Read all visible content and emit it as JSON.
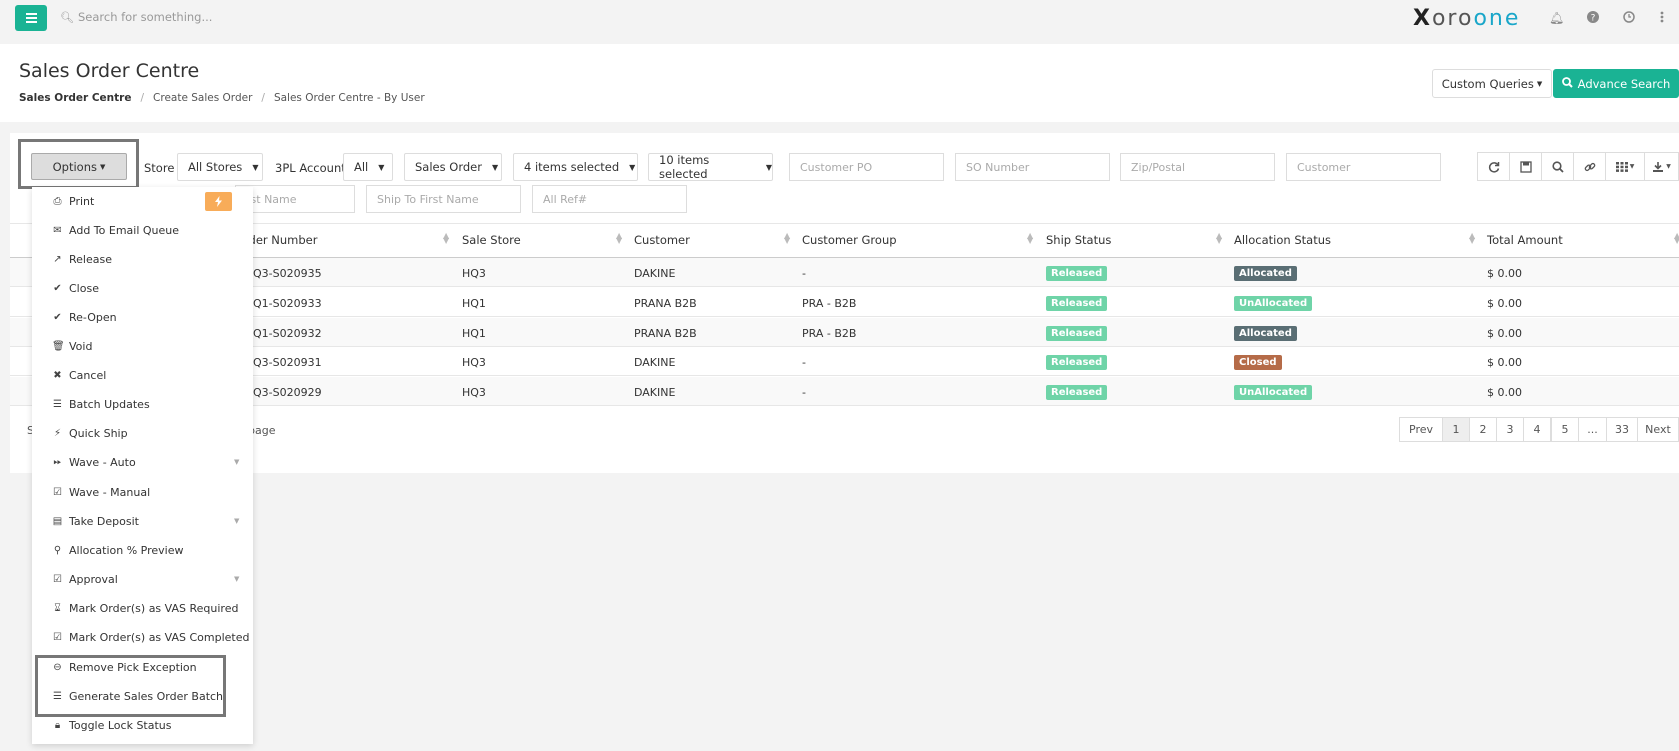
{
  "topbar": {
    "search_placeholder": "Search for something...",
    "logo_x": "X",
    "logo_oro": "oro",
    "logo_one": "one"
  },
  "header": {
    "title": "Sales Order Centre",
    "breadcrumb": [
      "Sales Order Centre",
      "Create Sales Order",
      "Sales Order Centre - By User"
    ],
    "custom_queries": "Custom Queries",
    "advance_search": "Advance Search"
  },
  "filters": {
    "options": "Options",
    "store_label": "Store",
    "store_value": "All Stores",
    "account_label": "3PL Account",
    "account_value": "All",
    "order_type": "Sales Order",
    "items_selected_1": "4 items selected",
    "items_selected_2": "10 items selected",
    "customer_po": "Customer PO",
    "so_number": "SO Number",
    "zip": "Zip/Postal",
    "customer": "Customer",
    "first_name": "Ship To First Name",
    "first_name_partial": "rst Name",
    "all_ref": "All Ref#"
  },
  "table": {
    "headers": [
      "rder Number",
      "Sale Store",
      "Customer",
      "Customer Group",
      "Ship Status",
      "Allocation Status",
      "Total Amount"
    ],
    "rows": [
      {
        "order": "Q3-S020935",
        "store": "HQ3",
        "customer": "DAKINE",
        "group": "-",
        "ship": "Released",
        "alloc": "Allocated",
        "alloc_color": "#5a6e74",
        "total": "$ 0.00"
      },
      {
        "order": "Q1-S020933",
        "store": "HQ1",
        "customer": "PRANA B2B",
        "group": "PRA - B2B",
        "ship": "Released",
        "alloc": "UnAllocated",
        "alloc_color": "#6fd4a8",
        "total": "$ 0.00"
      },
      {
        "order": "Q1-S020932",
        "store": "HQ1",
        "customer": "PRANA B2B",
        "group": "PRA - B2B",
        "ship": "Released",
        "alloc": "Allocated",
        "alloc_color": "#5a6e74",
        "total": "$ 0.00"
      },
      {
        "order": "Q3-S020931",
        "store": "HQ3",
        "customer": "DAKINE",
        "group": "-",
        "ship": "Released",
        "alloc": "Closed",
        "alloc_color": "#b56b48",
        "total": "$ 0.00"
      },
      {
        "order": "Q3-S020929",
        "store": "HQ3",
        "customer": "DAKINE",
        "group": "-",
        "ship": "Released",
        "alloc": "UnAllocated",
        "alloc_color": "#6fd4a8",
        "total": "$ 0.00"
      }
    ],
    "showing_s": "S",
    "showing_page": "page"
  },
  "pagination": [
    "Prev",
    "1",
    "2",
    "3",
    "4",
    "5",
    "...",
    "33",
    "Next"
  ],
  "menu": [
    {
      "label": "Print",
      "icon": "print-icon"
    },
    {
      "label": "Add To Email Queue",
      "icon": "envelope-icon"
    },
    {
      "label": "Release",
      "icon": "share-icon"
    },
    {
      "label": "Close",
      "icon": "check-icon"
    },
    {
      "label": "Re-Open",
      "icon": "check-icon"
    },
    {
      "label": "Void",
      "icon": "trash-icon"
    },
    {
      "label": "Cancel",
      "icon": "times-icon"
    },
    {
      "label": "Batch Updates",
      "icon": "list-icon"
    },
    {
      "label": "Quick Ship",
      "icon": "bolt-icon"
    },
    {
      "label": "Wave - Auto",
      "icon": "step-forward-icon"
    },
    {
      "label": "Wave - Manual",
      "icon": "check-square-icon"
    },
    {
      "label": "Take Deposit",
      "icon": "credit-card-icon"
    },
    {
      "label": "Allocation % Preview",
      "icon": "search-icon"
    },
    {
      "label": "Approval",
      "icon": "check-square-icon"
    },
    {
      "label": "Mark Order(s) as VAS Required",
      "icon": "hourglass-icon"
    },
    {
      "label": "Mark Order(s) as VAS Completed",
      "icon": "check-square-icon"
    },
    {
      "label": "Remove Pick Exception",
      "icon": "minus-circle-icon"
    },
    {
      "label": "Generate Sales Order Batch",
      "icon": "list-icon"
    },
    {
      "label": "Toggle Lock Status",
      "icon": "lock-icon"
    }
  ],
  "colors": {
    "accent": "#1ab394",
    "released": "#6fd4a8",
    "warning": "#f8ac59"
  }
}
